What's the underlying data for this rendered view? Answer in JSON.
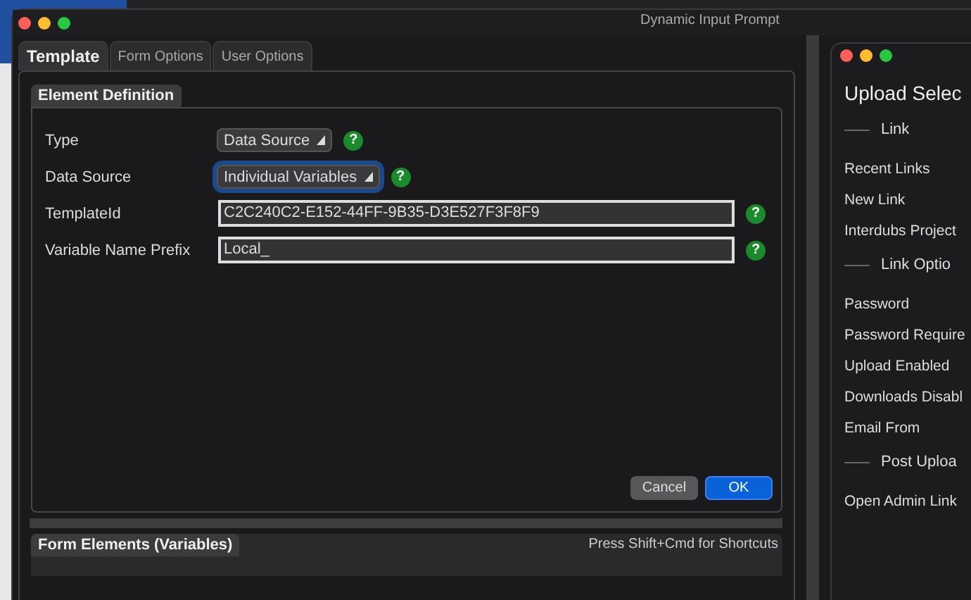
{
  "window": {
    "title": "Dynamic Input Prompt"
  },
  "tabs": [
    {
      "label": "Template",
      "selected": true
    },
    {
      "label": "Form Options",
      "selected": false
    },
    {
      "label": "User Options",
      "selected": false
    }
  ],
  "group": {
    "title": "Element Definition",
    "rows": [
      {
        "kind": "popup",
        "label": "Type",
        "value": "Data Source",
        "focused": false,
        "help": "?"
      },
      {
        "kind": "popup",
        "label": "Data Source",
        "value": "Individual Variables",
        "focused": true,
        "help": "?"
      },
      {
        "kind": "text",
        "label": "TemplateId",
        "value": "C2C240C2-E152-44FF-9B35-D3E527F3F8F9",
        "help": "?"
      },
      {
        "kind": "text",
        "label": "Variable Name Prefix",
        "value": "Local_",
        "help": "?"
      }
    ]
  },
  "buttons": [
    {
      "label": "Cancel",
      "default": false
    },
    {
      "label": "OK",
      "default": true
    }
  ],
  "form_elements": {
    "title": "Form Elements (Variables)",
    "hint": "Press Shift+Cmd for Shortcuts"
  },
  "side_window": {
    "title": "Upload Selec",
    "sections": [
      {
        "heading": "Link",
        "items": [
          "Recent Links",
          "New Link",
          "Interdubs Project"
        ]
      },
      {
        "heading": "Link Optio",
        "items": [
          "Password",
          "Password Require",
          "Upload Enabled",
          "Downloads Disabl",
          "Email From"
        ]
      },
      {
        "heading": "Post Uploa",
        "items": [
          "Open Admin Link"
        ]
      }
    ]
  }
}
